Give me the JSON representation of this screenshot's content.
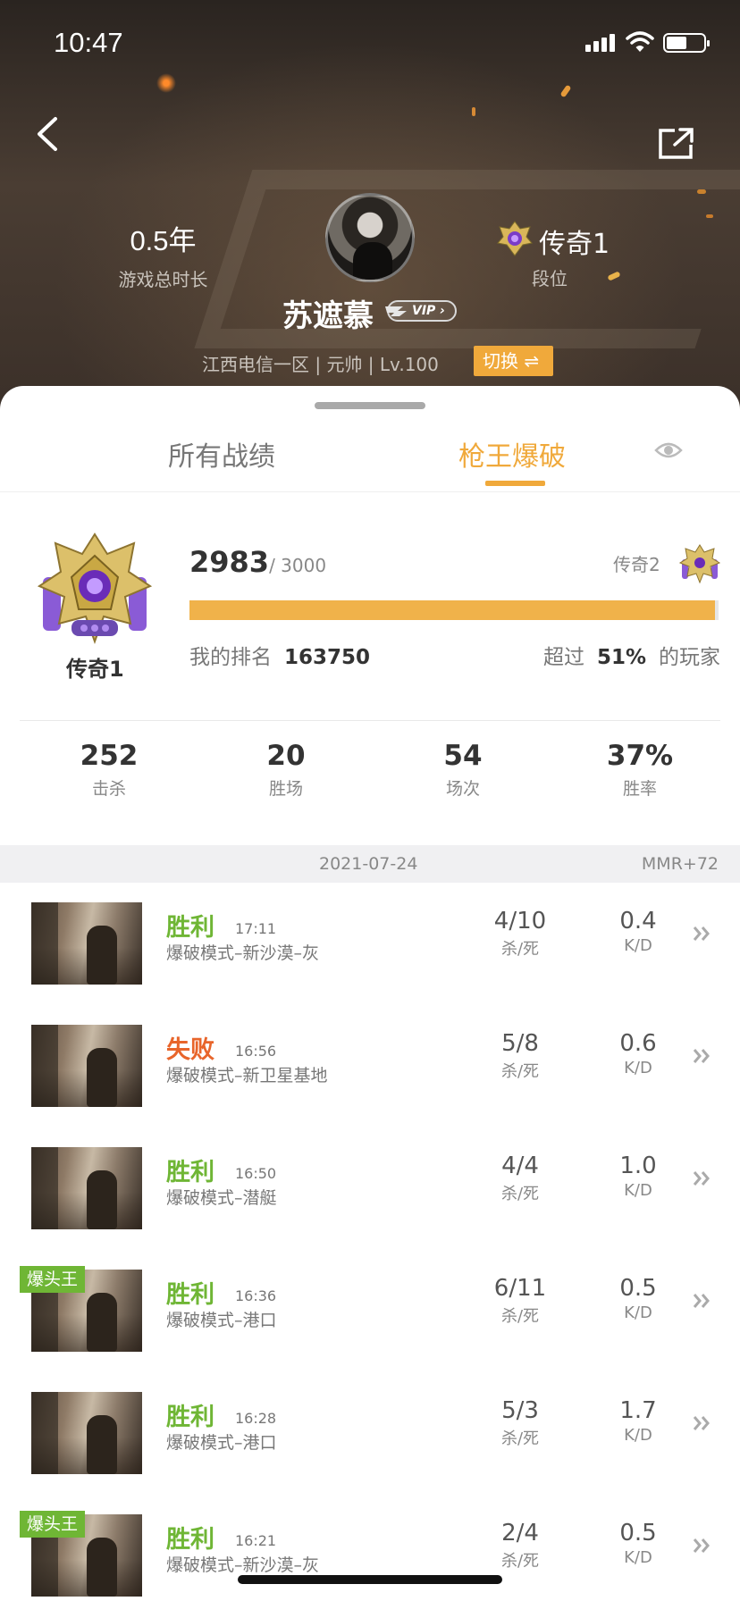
{
  "status_bar": {
    "time": "10:47"
  },
  "header": {
    "play_time_value": "0.5年",
    "play_time_label": "游戏总时长",
    "rank_value": "传奇1",
    "rank_label": "段位",
    "player_name": "苏遮慕",
    "vip_label": "VIP",
    "server_line": "江西电信一区 | 元帅 | Lv.100",
    "switch_label": "切换 ⇌"
  },
  "tabs": [
    {
      "label": "所有战绩",
      "active": false
    },
    {
      "label": "枪王爆破",
      "active": true
    }
  ],
  "rank_card": {
    "rank_name": "传奇1",
    "score": "2983",
    "score_max": "/ 3000",
    "progress": 0.994,
    "next_rank": "传奇2",
    "my_rank_label": "我的排名",
    "my_rank_value": "163750",
    "beat_prefix": "超过",
    "beat_value": "51%",
    "beat_suffix": "的玩家"
  },
  "summary": [
    {
      "value": "252",
      "label": "击杀"
    },
    {
      "value": "20",
      "label": "胜场"
    },
    {
      "value": "54",
      "label": "场次"
    },
    {
      "value": "37%",
      "label": "胜率"
    }
  ],
  "date_bar": {
    "date": "2021-07-24",
    "mmr": "MMR+72"
  },
  "matches": [
    {
      "result": "胜利",
      "outcome": "win",
      "time": "17:11",
      "mode": "爆破模式–新沙漠–灰",
      "kd_ratio_text": "4/10",
      "kd_ratio_label": "杀/死",
      "kd": "0.4",
      "kd_label": "K/D",
      "tag": ""
    },
    {
      "result": "失败",
      "outcome": "lose",
      "time": "16:56",
      "mode": "爆破模式–新卫星基地",
      "kd_ratio_text": "5/8",
      "kd_ratio_label": "杀/死",
      "kd": "0.6",
      "kd_label": "K/D",
      "tag": ""
    },
    {
      "result": "胜利",
      "outcome": "win",
      "time": "16:50",
      "mode": "爆破模式–潜艇",
      "kd_ratio_text": "4/4",
      "kd_ratio_label": "杀/死",
      "kd": "1.0",
      "kd_label": "K/D",
      "tag": ""
    },
    {
      "result": "胜利",
      "outcome": "win",
      "time": "16:36",
      "mode": "爆破模式–港口",
      "kd_ratio_text": "6/11",
      "kd_ratio_label": "杀/死",
      "kd": "0.5",
      "kd_label": "K/D",
      "tag": "爆头王"
    },
    {
      "result": "胜利",
      "outcome": "win",
      "time": "16:28",
      "mode": "爆破模式–港口",
      "kd_ratio_text": "5/3",
      "kd_ratio_label": "杀/死",
      "kd": "1.7",
      "kd_label": "K/D",
      "tag": ""
    },
    {
      "result": "胜利",
      "outcome": "win",
      "time": "16:21",
      "mode": "爆破模式–新沙漠–灰",
      "kd_ratio_text": "2/4",
      "kd_ratio_label": "杀/死",
      "kd": "0.5",
      "kd_label": "K/D",
      "tag": "爆头王"
    }
  ],
  "colors": {
    "accent": "#f0a93b",
    "win": "#6fb635",
    "lose": "#e8652b"
  },
  "icons": [
    "back-icon",
    "share-icon",
    "eye-icon",
    "chevron-right-icon",
    "signal-icon",
    "wifi-icon",
    "battery-icon"
  ]
}
